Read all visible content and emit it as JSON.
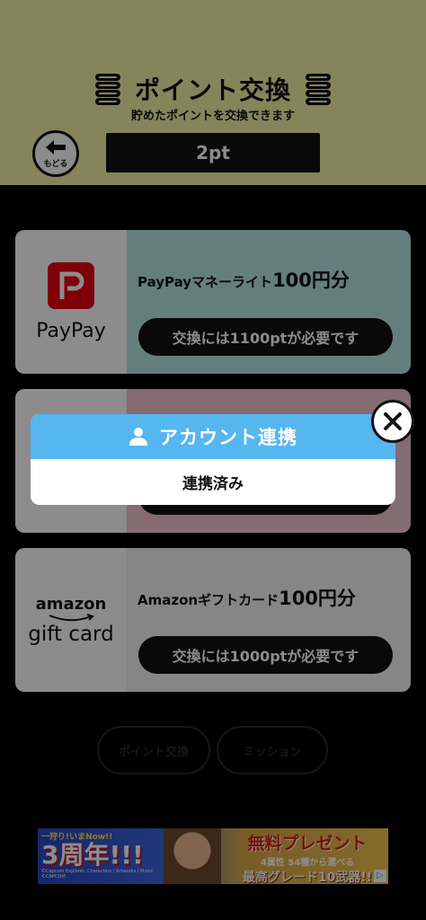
{
  "header": {
    "title": "ポイント交換",
    "subtitle": "貯めたポイントを交換できます",
    "back_label": "もどる",
    "points": "2pt"
  },
  "cards": [
    {
      "logo_text": "PayPay",
      "name": "PayPayマネーライト",
      "amount": "100円分",
      "button": "交換には1100ptが必要です",
      "bg": "#b7e6e6"
    },
    {
      "name": "",
      "amount": "",
      "button": "",
      "bg": "#f2c4cf"
    },
    {
      "logo_word": "amazon",
      "logo_sub": "gift card",
      "name": "Amazonギフトカード",
      "amount": "100円分",
      "button": "交換には1000ptが必要です",
      "bg": "#f4f4f4"
    }
  ],
  "nav": {
    "exchange": "ポイント交換",
    "mission": "ミッション"
  },
  "ad": {
    "tag": "一狩り!いまNow!!",
    "big": "3周年!!!",
    "copy": "©Capcom Explorer, Characters / Artworks / Music ©CAPCOM",
    "r1": "無料プレゼント",
    "r2": "4属性 54種から選べる",
    "r3": "最高グレード10武器!!",
    "choice": "▷"
  },
  "modal": {
    "title": "アカウント連携",
    "status": "連携済み",
    "icon": "person-icon",
    "accent": "#56b6ef"
  }
}
